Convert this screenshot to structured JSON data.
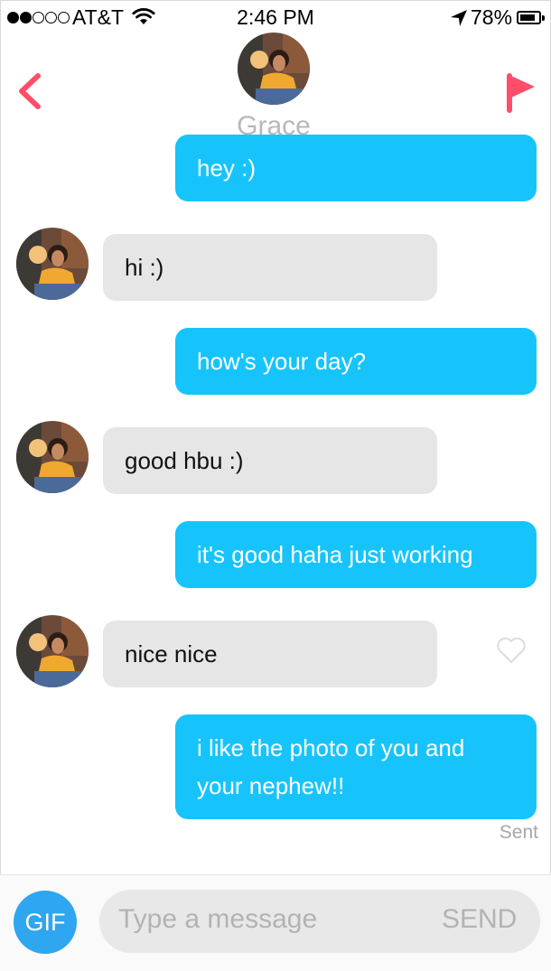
{
  "status_bar": {
    "carrier": "AT&T",
    "time": "2:46 PM",
    "battery": "78%",
    "signal_bars_filled": 2,
    "signal_bars_total": 5
  },
  "header": {
    "name": "Grace"
  },
  "messages": [
    {
      "from": "me",
      "text": "hey :)"
    },
    {
      "from": "them",
      "text": "hi :)"
    },
    {
      "from": "me",
      "text": "how's your day?"
    },
    {
      "from": "them",
      "text": "good hbu :)"
    },
    {
      "from": "me",
      "text": "it's good haha just working"
    },
    {
      "from": "them",
      "text": "nice nice"
    },
    {
      "from": "me",
      "text": "i like the photo of you and your nephew!!"
    }
  ],
  "sent_label": "Sent",
  "composer": {
    "gif_label": "GIF",
    "placeholder": "Type a message",
    "send_label": "SEND"
  },
  "colors": {
    "accent": "#ff4d6a",
    "my_bubble": "#16c4fb",
    "their_bubble": "#e6e6e6",
    "gif_button": "#2ea6f0"
  },
  "icons": [
    "back-chevron-icon",
    "flag-icon",
    "heart-icon",
    "wifi-icon",
    "location-arrow-icon",
    "battery-icon"
  ]
}
